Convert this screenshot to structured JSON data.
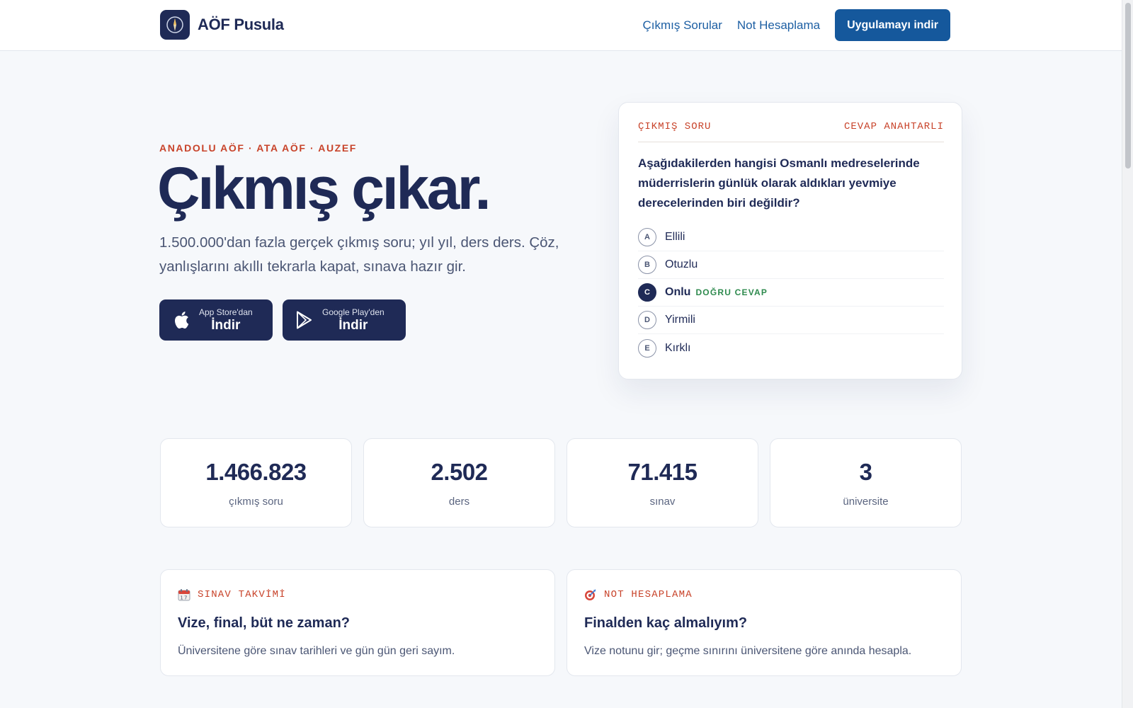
{
  "header": {
    "brand": "AÖF Pusula",
    "nav": {
      "link1": "Çıkmış Sorular",
      "link2": "Not Hesaplama",
      "cta": "Uygulamayı indir"
    }
  },
  "hero": {
    "eyebrow": "ANADOLU AÖF · ATA AÖF · AUZEF",
    "title": "Çıkmış çıkar.",
    "subtitle": "1.500.000'dan fazla gerçek çıkmış soru; yıl yıl, ders ders. Çöz, yanlışlarını akıllı tekrarla kapat, sınava hazır gir.",
    "apple": {
      "small": "App Store'dan",
      "big": "İndir"
    },
    "google": {
      "small": "Google Play'den",
      "big": "İndir"
    }
  },
  "question_card": {
    "label_left": "ÇIKMIŞ SORU",
    "label_right": "CEVAP ANAHTARLI",
    "question": "Aşağıdakilerden hangisi Osmanlı medreselerinde müderrislerin günlük olarak aldıkları yevmiye derecelerinden biri değildir?",
    "options": [
      {
        "letter": "A",
        "text": "Ellili"
      },
      {
        "letter": "B",
        "text": "Otuzlu"
      },
      {
        "letter": "C",
        "text": "Onlu"
      },
      {
        "letter": "D",
        "text": "Yirmili"
      },
      {
        "letter": "E",
        "text": "Kırklı"
      }
    ],
    "correct_tag": "DOĞRU CEVAP"
  },
  "stats": [
    {
      "value": "1.466.823",
      "label": "çıkmış soru"
    },
    {
      "value": "2.502",
      "label": "ders"
    },
    {
      "value": "71.415",
      "label": "sınav"
    },
    {
      "value": "3",
      "label": "üniversite"
    }
  ],
  "features": [
    {
      "icon": "calendar-icon",
      "tag": "SINAV TAKVİMİ",
      "title": "Vize, final, büt ne zaman?",
      "desc": "Üniversitene göre sınav tarihleri ve gün gün geri sayım."
    },
    {
      "icon": "target-icon",
      "tag": "NOT HESAPLAMA",
      "title": "Finalden kaç almalıyım?",
      "desc": "Vize notunu gir; geçme sınırını üniversitene göre anında hesapla."
    }
  ],
  "colors": {
    "navy": "#1f2a56",
    "accent": "#c8432a",
    "cta": "#15589c",
    "success": "#2e8a4e"
  }
}
